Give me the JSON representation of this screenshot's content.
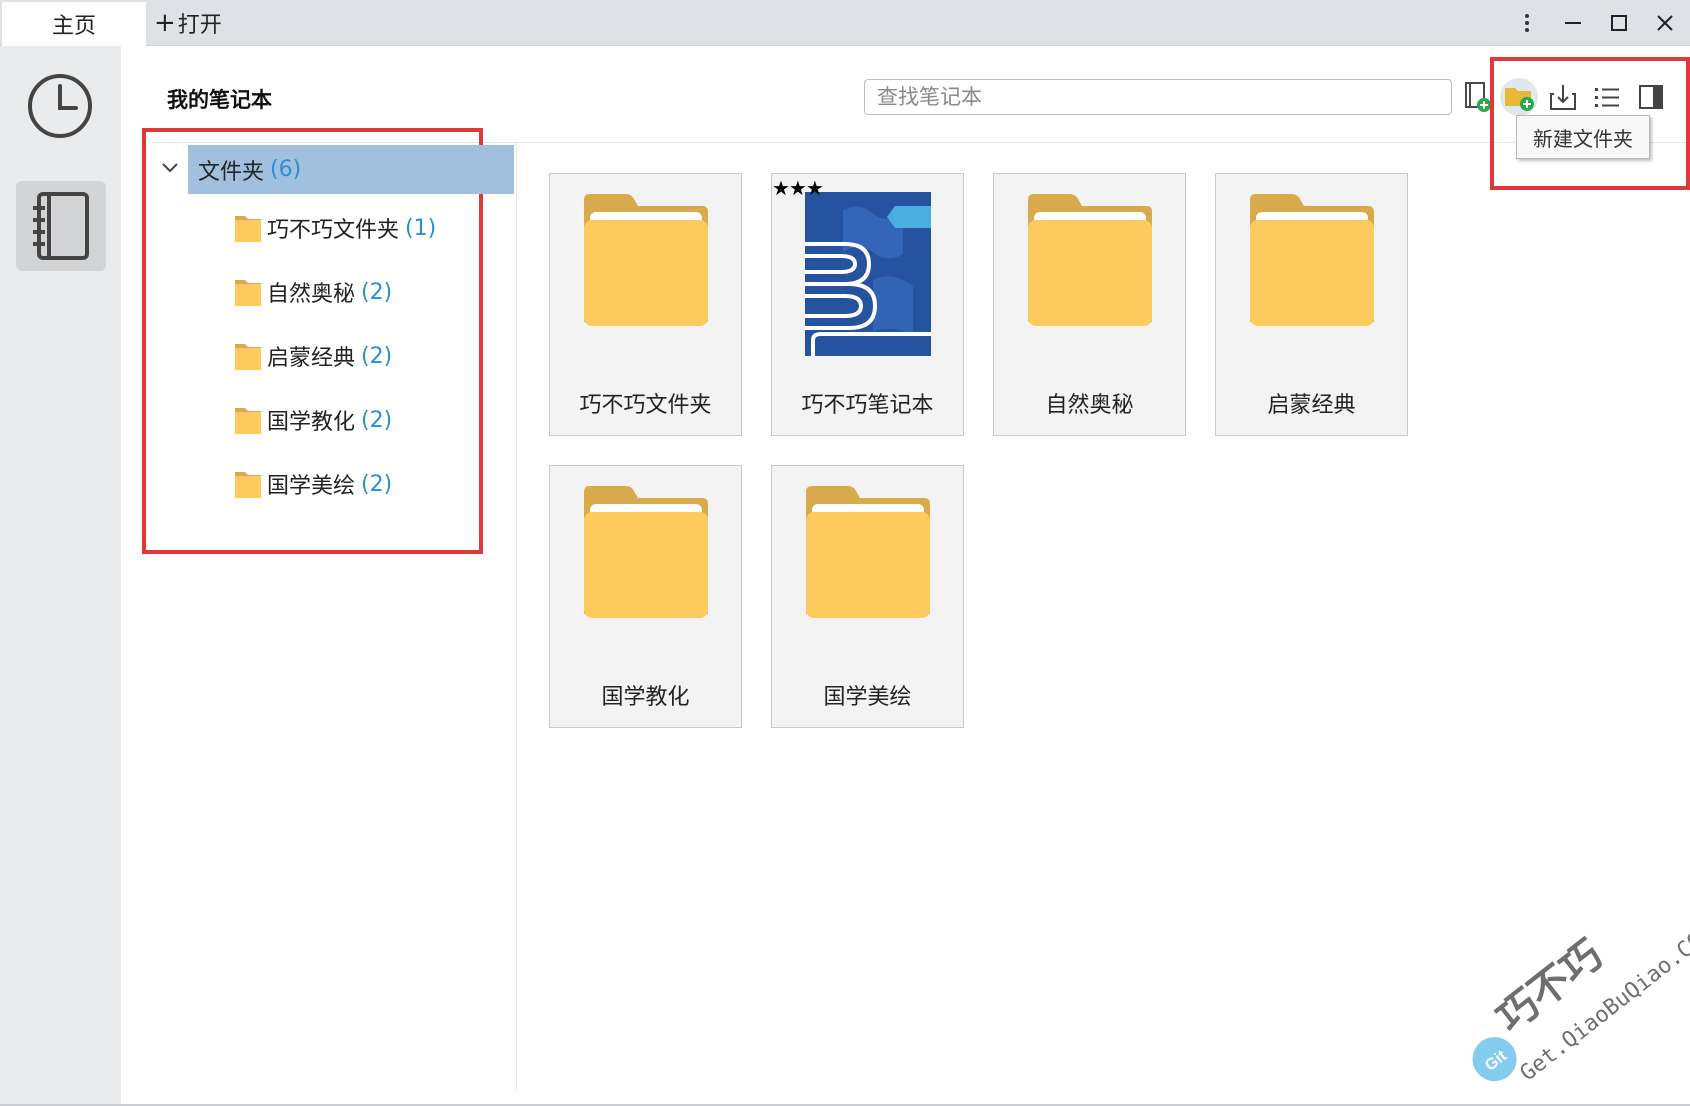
{
  "titlebar": {
    "tabs": [
      {
        "label": "主页"
      },
      {
        "label": "打开"
      }
    ]
  },
  "header": {
    "title": "我的笔记本",
    "search_placeholder": "查找笔记本",
    "tooltip": "新建文件夹"
  },
  "tree": {
    "root": {
      "label": "文件夹",
      "count": "(6)"
    },
    "items": [
      {
        "label": "巧不巧文件夹",
        "count": "(1)"
      },
      {
        "label": "自然奥秘",
        "count": "(2)"
      },
      {
        "label": "启蒙经典",
        "count": "(2)"
      },
      {
        "label": "国学教化",
        "count": "(2)"
      },
      {
        "label": "国学美绘",
        "count": "(2)"
      }
    ]
  },
  "grid": {
    "items": [
      {
        "label": "巧不巧文件夹",
        "type": "folder"
      },
      {
        "label": "巧不巧笔记本",
        "type": "notebook",
        "rating": "★★★"
      },
      {
        "label": "自然奥秘",
        "type": "folder"
      },
      {
        "label": "启蒙经典",
        "type": "folder"
      },
      {
        "label": "国学教化",
        "type": "folder"
      },
      {
        "label": "国学美绘",
        "type": "folder"
      }
    ]
  },
  "watermark": {
    "brand": "巧不巧",
    "url": "Get.QiaoBuQiao.COM",
    "badge": "Git"
  },
  "colors": {
    "accent_selection": "#a0c0dd",
    "count_blue": "#2a8fd0",
    "highlight_red": "#e0383b",
    "folder_yellow": "#fdcb5d",
    "notebook_blue": "#2553a0"
  },
  "icons": {
    "rail": [
      "clock-icon",
      "notebook-icon"
    ],
    "toolbar": [
      "new-notebook-icon",
      "new-folder-icon",
      "import-icon",
      "list-view-icon",
      "panel-toggle-icon"
    ],
    "window": [
      "more-icon",
      "minimize-icon",
      "maximize-icon",
      "close-icon"
    ]
  }
}
